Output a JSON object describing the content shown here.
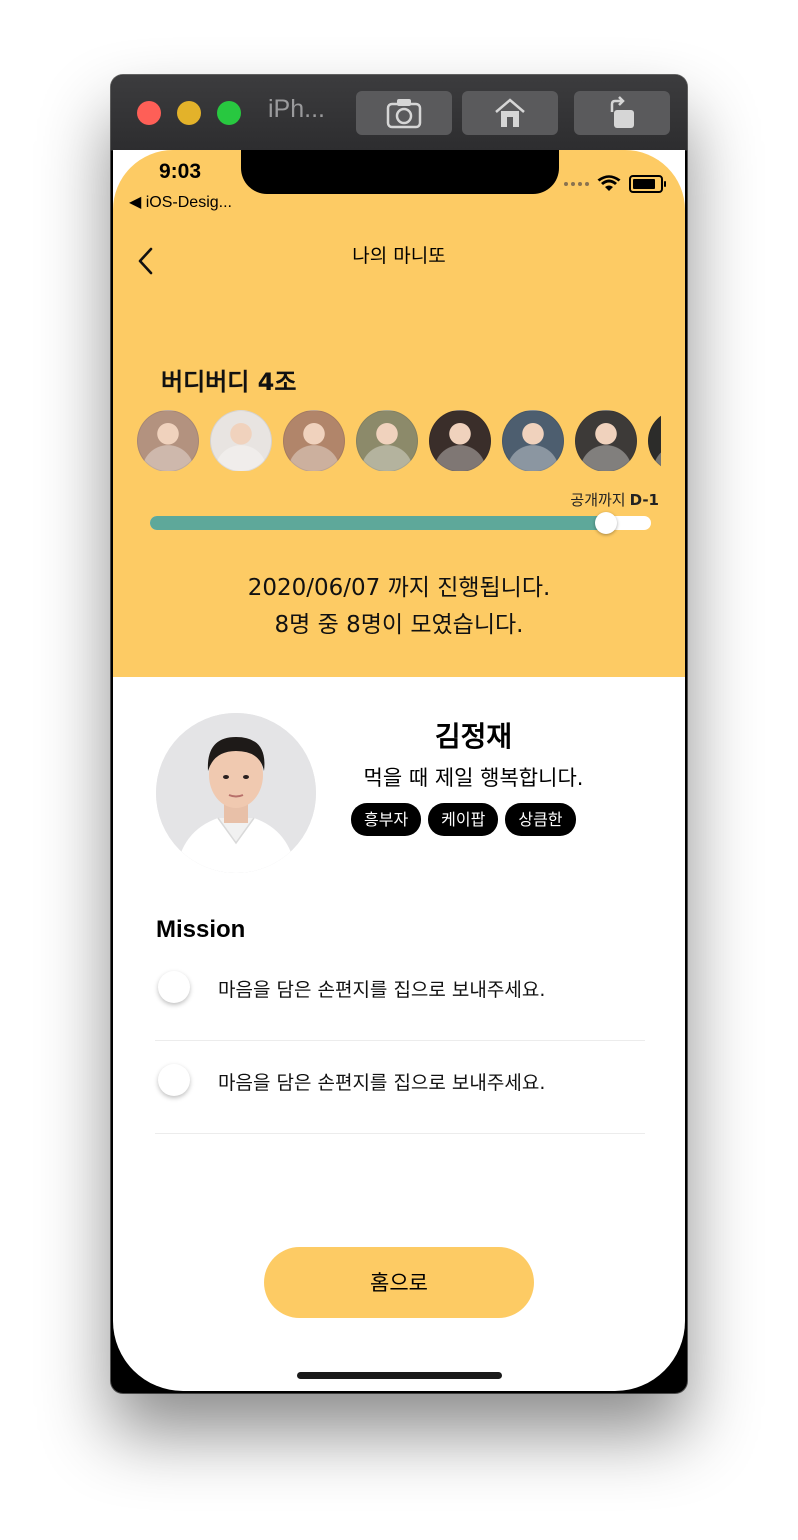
{
  "window": {
    "title": "iPh..."
  },
  "status_bar": {
    "time": "9:03",
    "back_app": "◀ iOS-Desig..."
  },
  "header": {
    "title": "나의 마니또"
  },
  "group": {
    "name": "버디버디 4조",
    "members": [
      {
        "color": "#b3927f"
      },
      {
        "color": "#e8e4e1"
      },
      {
        "color": "#b1856a"
      },
      {
        "color": "#8c8a6a"
      },
      {
        "color": "#3a2e2a"
      },
      {
        "color": "#4d5e6f"
      },
      {
        "color": "#3d3a38"
      },
      {
        "color": "#2c2c2a"
      }
    ],
    "dday_label": "공개까지",
    "dday_value": "D-1",
    "progress": 0.91,
    "period_text": "2020/06/07 까지 진행됩니다.",
    "members_text": "8명 중 8명이 모였습니다."
  },
  "profile": {
    "name": "김정재",
    "bio": "먹을 때 제일 행복합니다.",
    "tags": [
      "흥부자",
      "케이팝",
      "상큼한"
    ]
  },
  "mission": {
    "title": "Mission",
    "items": [
      {
        "text": "마음을 담은 손편지를 집으로 보내주세요.",
        "done": false
      },
      {
        "text": "마음을 담은 손편지를 집으로 보내주세요.",
        "done": false
      }
    ]
  },
  "footer": {
    "home_label": "홈으로"
  },
  "colors": {
    "accent": "#fdcb64",
    "progress": "#5ea89a"
  }
}
